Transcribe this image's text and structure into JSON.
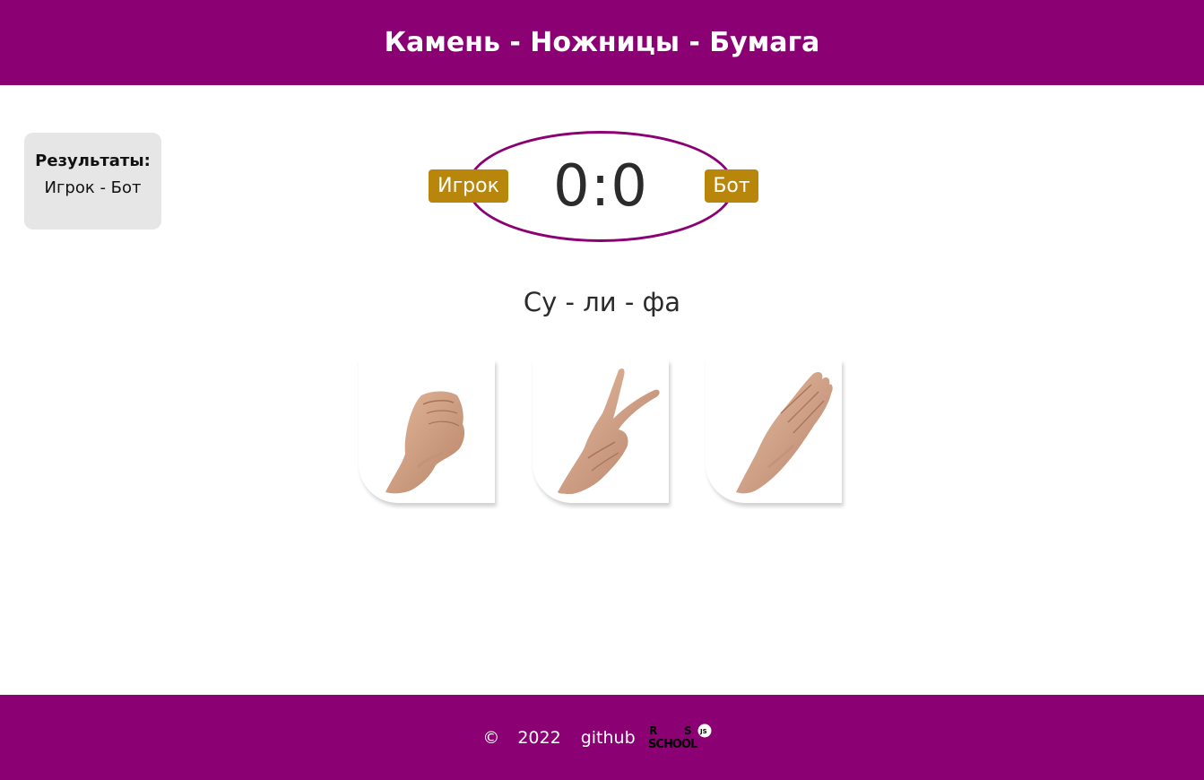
{
  "header": {
    "title": "Камень - Ножницы - Бумага"
  },
  "results": {
    "title": "Результаты:",
    "subtitle": "Игрок - Бот"
  },
  "score": {
    "player_label": "Игрок",
    "bot_label": "Бот",
    "value": "0:0"
  },
  "game": {
    "chant": "Су - ли - фа"
  },
  "choices": [
    {
      "id": "rock",
      "icon": "fist-hand-icon"
    },
    {
      "id": "scissors",
      "icon": "v-sign-hand-icon"
    },
    {
      "id": "paper",
      "icon": "flat-hand-icon"
    }
  ],
  "footer": {
    "copyright": "©",
    "year": "2022",
    "link": "github",
    "logo_text": "RS SCHOOL JS"
  },
  "colors": {
    "primary": "#8b0073",
    "tag": "#b8860b",
    "results_bg": "#e6e6e6",
    "text": "#2b2b2b"
  }
}
